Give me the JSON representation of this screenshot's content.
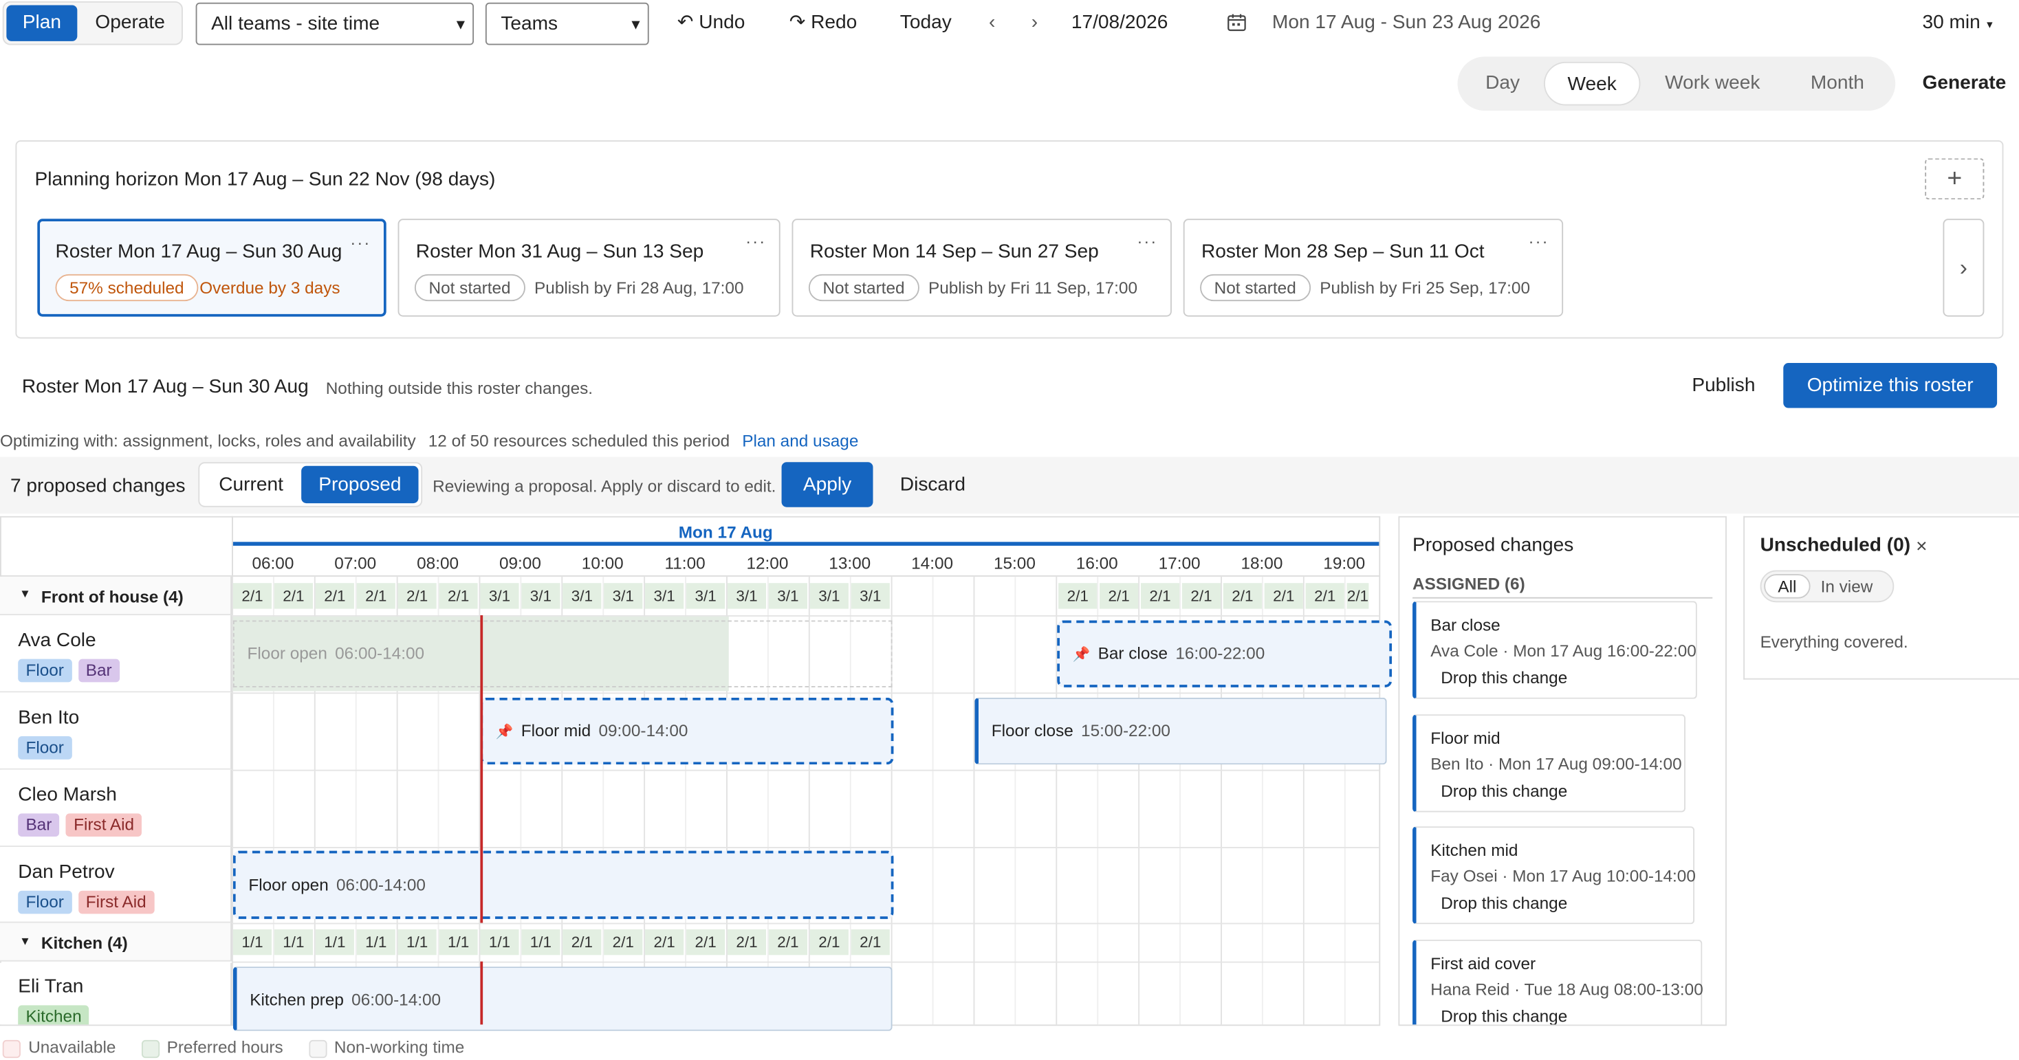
{
  "mode_toggle": {
    "plan": "Plan",
    "operate": "Operate"
  },
  "team_select": "All teams - site time",
  "group_select": "Teams",
  "toolbar": {
    "undo": "Undo",
    "redo": "Redo",
    "today": "Today",
    "date": "17/08/2026",
    "range": "Mon 17 Aug - Sun 23 Aug 2026",
    "slot": "30 min"
  },
  "views": [
    "Day",
    "Week",
    "Work week",
    "Month"
  ],
  "active_view": "Week",
  "generate_label": "Generate",
  "horizon": {
    "title": "Planning horizon Mon 17 Aug – Sun 22 Nov (98 days)",
    "add": "+",
    "next": "›",
    "rosters": [
      {
        "title": "Roster Mon 17 Aug – Sun 30 Aug",
        "status": "57% scheduled",
        "note": "Overdue by 3 days",
        "selected": true
      },
      {
        "title": "Roster Mon 31 Aug – Sun 13 Sep",
        "status": "Not started",
        "note": "Publish by Fri 28 Aug, 17:00"
      },
      {
        "title": "Roster Mon 14 Sep – Sun 27 Sep",
        "status": "Not started",
        "note": "Publish by Fri 11 Sep, 17:00"
      },
      {
        "title": "Roster Mon 28 Sep – Sun 11 Oct",
        "status": "Not started",
        "note": "Publish by Fri 25 Sep, 17:00"
      }
    ]
  },
  "roster_bar": {
    "title": "Roster Mon 17 Aug – Sun 30 Aug",
    "note": "Nothing outside this roster changes.",
    "publish": "Publish",
    "optimize": "Optimize this roster"
  },
  "opt_info": {
    "text": "Optimizing with: assignment, locks, roles and availability",
    "count": "12 of 50 resources scheduled this period",
    "link": "Plan and usage"
  },
  "proposal": {
    "count": "7 proposed changes",
    "current": "Current",
    "proposed": "Proposed",
    "note": "Reviewing a proposal. Apply or discard to edit.",
    "apply": "Apply",
    "discard": "Discard"
  },
  "timeline": {
    "day": "Mon 17 Aug",
    "hours": [
      "06:00",
      "07:00",
      "08:00",
      "09:00",
      "10:00",
      "11:00",
      "12:00",
      "13:00",
      "14:00",
      "15:00",
      "16:00",
      "17:00",
      "18:00",
      "19:00"
    ],
    "groups": [
      {
        "name": "Front of house (4)",
        "coverage_am": [
          "2/1",
          "2/1",
          "2/1",
          "2/1",
          "2/1",
          "2/1",
          "3/1",
          "3/1",
          "3/1",
          "3/1",
          "3/1",
          "3/1",
          "3/1",
          "3/1",
          "3/1",
          "3/1"
        ],
        "coverage_pm": [
          "2/1",
          "2/1",
          "2/1",
          "2/1",
          "2/1",
          "2/1",
          "2/1",
          "2/1"
        ]
      },
      {
        "name": "Kitchen (4)",
        "coverage_am": [
          "1/1",
          "1/1",
          "1/1",
          "1/1",
          "1/1",
          "1/1",
          "1/1",
          "1/1",
          "2/1",
          "2/1",
          "2/1",
          "2/1",
          "2/1",
          "2/1",
          "2/1",
          "2/1"
        ]
      }
    ],
    "people": [
      {
        "name": "Ava Cole",
        "tags": [
          "Floor",
          "Bar"
        ]
      },
      {
        "name": "Ben Ito",
        "tags": [
          "Floor"
        ]
      },
      {
        "name": "Cleo Marsh",
        "tags": [
          "Bar",
          "First Aid"
        ]
      },
      {
        "name": "Dan Petrov",
        "tags": [
          "Floor",
          "First Aid"
        ]
      },
      {
        "name": "Eli Tran",
        "tags": [
          "Kitchen"
        ]
      }
    ],
    "shifts": {
      "ava_ghost": {
        "label": "Floor open",
        "time": "06:00-14:00"
      },
      "ava_bar": {
        "label": "Bar close",
        "time": "16:00-22:00"
      },
      "ben_mid": {
        "label": "Floor mid",
        "time": "09:00-14:00"
      },
      "ben_close": {
        "label": "Floor close",
        "time": "15:00-22:00"
      },
      "dan_open": {
        "label": "Floor open",
        "time": "06:00-14:00"
      },
      "eli_prep": {
        "label": "Kitchen prep",
        "time": "06:00-14:00"
      }
    }
  },
  "proposed_panel": {
    "title": "Proposed changes",
    "section": "ASSIGNED (6)",
    "items": [
      {
        "title": "Bar close",
        "detail": "Ava Cole · Mon 17 Aug 16:00-22:00",
        "action": "Drop this change"
      },
      {
        "title": "Floor mid",
        "detail": "Ben Ito · Mon 17 Aug 09:00-14:00",
        "action": "Drop this change"
      },
      {
        "title": "Kitchen mid",
        "detail": "Fay Osei · Mon 17 Aug 10:00-14:00",
        "action": "Drop this change"
      },
      {
        "title": "First aid cover",
        "detail": "Hana Reid · Tue 18 Aug 08:00-13:00",
        "action": "Drop this change"
      }
    ]
  },
  "unscheduled": {
    "title": "Unscheduled (0)",
    "close": "×",
    "all": "All",
    "in_view": "In view",
    "empty": "Everything covered."
  },
  "legend": [
    "Unavailable",
    "Preferred hours",
    "Non-working time"
  ],
  "colors": {
    "primary": "#1565c0",
    "overdue": "#c0560c",
    "now_line": "#c62828",
    "floor_tag": "#bcd7f5",
    "bar_tag": "#d9c7ec",
    "firstaid_tag": "#f7c6c6",
    "kitchen_tag": "#c6e6c4"
  }
}
